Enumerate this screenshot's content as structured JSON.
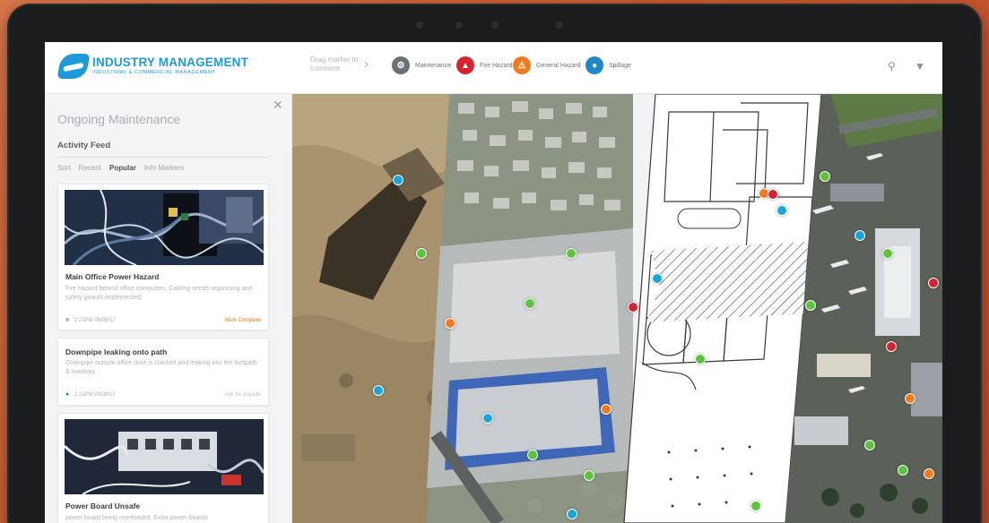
{
  "brand": {
    "title": "INDUSTRY MANAGEMENT",
    "subtitle": "INDUSTRIAL & COMMERCIAL MANAGEMENT"
  },
  "toolbar": {
    "drag_hint": "Drag marker to comment",
    "legend": [
      {
        "label": "Maintenance",
        "color": "#6b7176",
        "icon": "wrench-icon"
      },
      {
        "label": "Fire Hazard",
        "color": "#d6232f",
        "icon": "fire-icon"
      },
      {
        "label": "General Hazard",
        "color": "#f07b1e",
        "icon": "warning-icon"
      },
      {
        "label": "Spillage",
        "color": "#1e86c9",
        "icon": "droplet-icon"
      }
    ]
  },
  "sidebar": {
    "title": "Ongoing Maintenance",
    "feed_label": "Activity Feed",
    "filters": {
      "sort": "Sort",
      "recent": "Recent",
      "popular": "Popular",
      "info": "Info Markers"
    },
    "cards": [
      {
        "title": "Main Office Power Hazard",
        "desc": "Fire hazard behind office computers. Cabling needs organising and safety guards implemented.",
        "meta": "2:21PM 09/08/17",
        "action": "Mark Complete",
        "action_color": "#f07b1e"
      },
      {
        "title": "Downpipe leaking onto path",
        "desc": "Downpipe outside office door is cracked and leaking into the footpath & roadway.",
        "meta": "2:21PM 09/08/17",
        "action": "Ask for a quote",
        "action_color": "#b8bcc0"
      },
      {
        "title": "Power Board Unsafe",
        "desc": "power board being overloaded. Extra power boards"
      }
    ]
  },
  "map": {
    "markers": [
      {
        "type": "spillage",
        "color": "#1aa6d8"
      },
      {
        "type": "maintenance",
        "color": "#5dc23d"
      },
      {
        "type": "general",
        "color": "#f07b1e"
      },
      {
        "type": "spillage",
        "color": "#1aa6d8"
      },
      {
        "type": "maintenance",
        "color": "#5dc23d"
      },
      {
        "type": "maintenance",
        "color": "#5dc23d"
      },
      {
        "type": "fire",
        "color": "#d6232f"
      },
      {
        "type": "general",
        "color": "#f07b1e"
      },
      {
        "type": "spillage",
        "color": "#1aa6d8"
      },
      {
        "type": "maintenance",
        "color": "#5dc23d"
      },
      {
        "type": "maintenance",
        "color": "#5dc23d"
      },
      {
        "type": "general",
        "color": "#f07b1e"
      },
      {
        "type": "fire",
        "color": "#d6232f"
      },
      {
        "type": "spillage",
        "color": "#1aa6d8"
      },
      {
        "type": "spillage",
        "color": "#1aa6d8"
      },
      {
        "type": "maintenance",
        "color": "#5dc23d"
      },
      {
        "type": "maintenance",
        "color": "#5dc23d"
      },
      {
        "type": "maintenance",
        "color": "#5dc23d"
      },
      {
        "type": "spillage",
        "color": "#1aa6d8"
      },
      {
        "type": "maintenance",
        "color": "#5dc23d"
      },
      {
        "type": "fire",
        "color": "#d6232f"
      },
      {
        "type": "maintenance",
        "color": "#5dc23d"
      },
      {
        "type": "fire",
        "color": "#d6232f"
      },
      {
        "type": "general",
        "color": "#f07b1e"
      },
      {
        "type": "maintenance",
        "color": "#5dc23d"
      },
      {
        "type": "maintenance",
        "color": "#5dc23d"
      },
      {
        "type": "general",
        "color": "#f07b1e"
      },
      {
        "type": "spillage",
        "color": "#1aa6d8"
      }
    ]
  }
}
